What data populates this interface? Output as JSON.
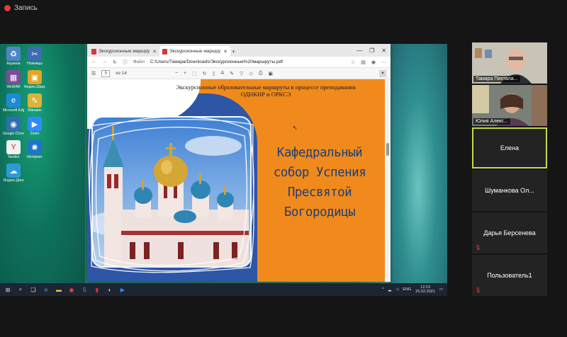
{
  "recording": {
    "label": "Запись",
    "color": "#e23b3b"
  },
  "desktop": {
    "icons": [
      {
        "label": "Корзина",
        "icon": "recycle-bin-icon",
        "color": "#4f86c6",
        "glyph": "♻"
      },
      {
        "label": "Ножницы",
        "icon": "snipping-tool-icon",
        "color": "#3c6db0",
        "glyph": "✂"
      },
      {
        "label": "WinRAR",
        "icon": "winrar-icon",
        "color": "#7c4d9a",
        "glyph": "▦"
      },
      {
        "label": "Яндекс.Браузер",
        "icon": "archive-icon",
        "color": "#e0a527",
        "glyph": "▣"
      },
      {
        "label": "Microsoft Edge",
        "icon": "edge-icon",
        "color": "#1d8ad8",
        "glyph": "e"
      },
      {
        "label": "Магазин",
        "icon": "store-icon",
        "color": "#d8b43a",
        "glyph": "✎"
      },
      {
        "label": "Google Chrome",
        "icon": "chrome-icon",
        "color": "#2e6fb0",
        "glyph": "◉"
      },
      {
        "label": "Zoom",
        "icon": "zoom-icon",
        "color": "#2d8cff",
        "glyph": "▶"
      },
      {
        "label": "Yandex",
        "icon": "yandex-icon",
        "color": "#f2f2f2",
        "glyph": "Y"
      },
      {
        "label": "Интернет",
        "icon": "network-icon",
        "color": "#1f74c6",
        "glyph": "✺"
      },
      {
        "label": "Яндекс.Диск",
        "icon": "yandex-disk-icon",
        "color": "#2d9ad8",
        "glyph": "☁"
      }
    ]
  },
  "browser": {
    "tabs": [
      {
        "label": "Экскурсионные маршруты.pdf",
        "active": false
      },
      {
        "label": "Экскурсионные маршруты.pdf",
        "active": true
      }
    ],
    "new_tab": "+",
    "window_controls": [
      "—",
      "❐",
      "✕"
    ],
    "address": "C:/Users/Тамара/Downloads/Экскурсионные%20маршруты.pdf",
    "address_prefix": "Файл",
    "pdf_toolbar": {
      "page": "5",
      "page_total": "из 14",
      "zoom_out": "−",
      "zoom_in": "+"
    }
  },
  "slide": {
    "subtitle_line1": "Экскурсионные образовательные маршруты в процессе преподавания",
    "subtitle_line2": "ОДНКНР и ОРКСЭ",
    "heading_lines": [
      "Кафедральный",
      "собор Успения",
      "Пресвятой",
      "Богородицы"
    ],
    "colors": {
      "orange": "#f08a1c",
      "navy": "#2e55a6",
      "heading": "#1f3e7a"
    }
  },
  "taskbar": {
    "lang": "ENG",
    "time": "12:23",
    "date": "25.02.2021"
  },
  "participants": [
    {
      "name": "Тамара Пихтала...",
      "type": "video"
    },
    {
      "name": "Юлия Алекс...",
      "type": "video"
    },
    {
      "name": "Елена",
      "type": "name",
      "speaking": true
    },
    {
      "name": "Шуманкова  Ол...",
      "type": "name",
      "muted": false
    },
    {
      "name": "Дарья Берсенева",
      "type": "name",
      "muted": true
    },
    {
      "name": "Пользователь1",
      "type": "name",
      "muted": true
    }
  ]
}
